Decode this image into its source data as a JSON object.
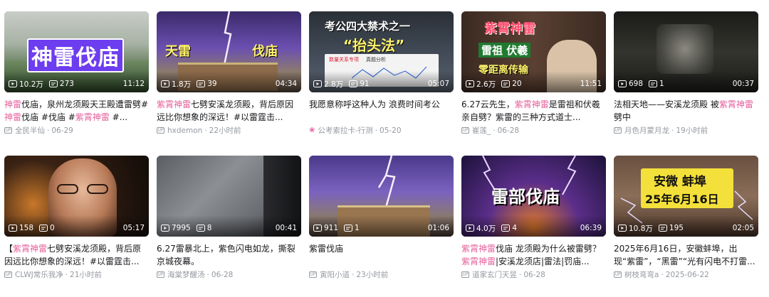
{
  "videos": [
    {
      "plays": "10.2万",
      "comments": "273",
      "duration": "11:12",
      "title_segments": [
        {
          "t": "神雷",
          "hl": true
        },
        {
          "t": "伐庙，泉州龙须殿天王殿遭雷劈#",
          "hl": false
        },
        {
          "t": "神雷",
          "hl": true
        },
        {
          "t": "伐庙 #伐庙 #",
          "hl": false
        },
        {
          "t": "紫霄神雷",
          "hl": true
        },
        {
          "t": " #...",
          "hl": false
        }
      ],
      "author": "全民半仙",
      "date": "06-29",
      "author_icon": "up-icon",
      "thumb_text": [
        "神雷伐庙"
      ]
    },
    {
      "plays": "1.8万",
      "comments": "39",
      "duration": "04:34",
      "title_segments": [
        {
          "t": "紫霄神雷",
          "hl": true
        },
        {
          "t": "七劈安溪龙须殿，背后原因远比你想象的深远！#以雷霆击...",
          "hl": false
        }
      ],
      "author": "hxdemon",
      "date": "22小时前",
      "author_icon": "up-icon",
      "thumb_text": [
        "天雷",
        "伐庙"
      ]
    },
    {
      "plays": "2.8万",
      "comments": "91",
      "duration": "05:07",
      "title_segments": [
        {
          "t": "我愿意称呼这种人为 浪费时间考公",
          "hl": false
        }
      ],
      "author": "公考索拉卡-行测",
      "date": "05-20",
      "author_icon": "charge-icon",
      "thumb_text": [
        "考公四大禁术之一",
        "“抬头法”",
        "数量关系专项",
        "真题分析"
      ]
    },
    {
      "plays": "2.6万",
      "comments": "20",
      "duration": "11:51",
      "title_segments": [
        {
          "t": "6.27云先生，",
          "hl": false
        },
        {
          "t": "紫霄神雷",
          "hl": true
        },
        {
          "t": "是雷祖和伏羲亲自劈？紫雷的三种方式道士...",
          "hl": false
        }
      ],
      "author": "崔莲_",
      "date": "06-28",
      "author_icon": "up-icon",
      "thumb_text": [
        "紫霄神雷",
        "雷祖 伏羲",
        "零距离传输"
      ]
    },
    {
      "plays": "698",
      "comments": "1",
      "duration": "00:37",
      "title_segments": [
        {
          "t": "法相天地——安溪龙须殿 被",
          "hl": false
        },
        {
          "t": "紫霄神雷",
          "hl": true
        },
        {
          "t": "劈中",
          "hl": false
        }
      ],
      "author": "月色月蒙月龙",
      "date": "19小时前",
      "author_icon": "up-icon",
      "thumb_text": []
    },
    {
      "plays": "158",
      "comments": "0",
      "duration": "05:17",
      "title_segments": [
        {
          "t": "【",
          "hl": false
        },
        {
          "t": "紫霄神雷",
          "hl": true
        },
        {
          "t": "七劈安溪龙须殿，背后原因远比你想象的深远！#以雷霆击...",
          "hl": false
        }
      ],
      "author": "CLWJ常乐我净",
      "date": "21小时前",
      "author_icon": "up-icon",
      "thumb_text": []
    },
    {
      "plays": "7995",
      "comments": "8",
      "duration": "00:41",
      "title_segments": [
        {
          "t": "6.27雷暴北上，紫色闪电如龙，撕裂京城夜幕。",
          "hl": false
        }
      ],
      "author": "海棠梦醒汤",
      "date": "06-28",
      "author_icon": "up-icon",
      "thumb_text": []
    },
    {
      "plays": "911",
      "comments": "1",
      "duration": "01:06",
      "title_segments": [
        {
          "t": "紫雷伐庙",
          "hl": false
        }
      ],
      "author": "寅阳小道",
      "date": "23小时前",
      "author_icon": "up-icon",
      "thumb_text": []
    },
    {
      "plays": "4.0万",
      "comments": "4",
      "duration": "06:39",
      "title_segments": [
        {
          "t": "紫霄神雷",
          "hl": true
        },
        {
          "t": "伐庙 龙须殿为什么被雷劈？ ",
          "hl": false
        },
        {
          "t": "紫霄神雷",
          "hl": true
        },
        {
          "t": "|安溪龙须店|雷法|罚庙...",
          "hl": false
        }
      ],
      "author": "道家玄门天昱",
      "date": "06-28",
      "author_icon": "up-icon",
      "thumb_text": [
        "雷部伐庙"
      ]
    },
    {
      "plays": "10.8万",
      "comments": "195",
      "duration": "02:05",
      "title_segments": [
        {
          "t": "2025年6月16日，安徽蚌埠，出现“紫雷”，“黑雷”“光有闪电不打雷...",
          "hl": false
        }
      ],
      "author": "树枝弯弯a",
      "date": "2025-06-22",
      "author_icon": "up-icon",
      "thumb_text": [
        "安微 蚌埠",
        "25年6月16日"
      ]
    }
  ],
  "colors": {
    "highlight": "#e5609c",
    "meta": "#9499a0",
    "title": "#18191c"
  },
  "icons": {
    "play": "play-count-icon",
    "comment": "danmaku-count-icon",
    "up": "up-icon",
    "charge": "charge-icon"
  }
}
